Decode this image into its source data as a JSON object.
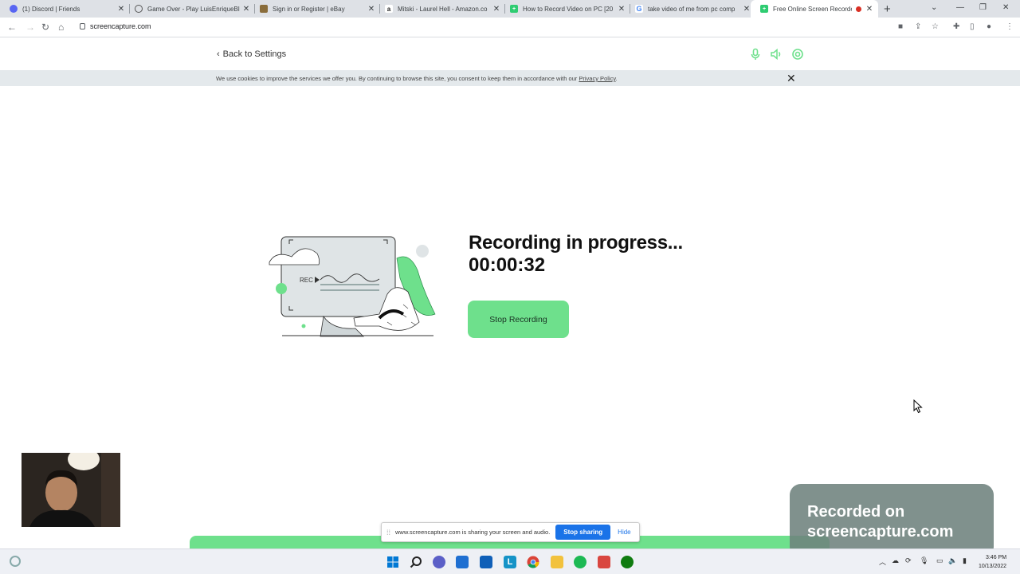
{
  "browser": {
    "tabs": [
      {
        "title": "(1) Discord | Friends",
        "favicon": "discord-icon",
        "color": "#5865f2"
      },
      {
        "title": "Game Over - Play LuisEnriqueBl",
        "favicon": "game-icon",
        "color": "#555555"
      },
      {
        "title": "Sign in or Register | eBay",
        "favicon": "bag-icon",
        "color": "#8a6d3b"
      },
      {
        "title": "Mitski - Laurel Hell - Amazon.co",
        "favicon": "amazon-icon",
        "color": "#222222"
      },
      {
        "title": "How to Record Video on PC [20",
        "favicon": "screencapture-icon",
        "color": "#2ecc71"
      },
      {
        "title": "take video of me from pc comp",
        "favicon": "google-icon",
        "color": "#4285f4"
      },
      {
        "title": "Free Online Screen Recorde",
        "favicon": "screencapture-icon",
        "color": "#2ecc71",
        "active": true
      }
    ],
    "new_tab": "+",
    "url": "screencapture.com"
  },
  "header": {
    "back_label": "Back to Settings",
    "icons": [
      "microphone-icon",
      "speaker-icon",
      "webcam-icon"
    ],
    "accent": "#6ee08c"
  },
  "cookie_banner": {
    "text": "We use cookies to improve the services we offer you. By continuing to browse this site, you consent to keep them in accordance with our",
    "link": "Privacy Policy",
    "period": "."
  },
  "recording": {
    "illustration_label": "REC",
    "status": "Recording in progress...",
    "timer": "00:00:32",
    "stop_button": "Stop Recording"
  },
  "share_bar": {
    "grip": "⁞⁞",
    "message": "www.screencapture.com is sharing your screen and audio.",
    "stop_label": "Stop sharing",
    "hide_label": "Hide"
  },
  "watermark": {
    "line1": "Recorded on",
    "line2": "screencapture.com"
  },
  "taskbar": {
    "time": "3:46 PM",
    "date": "10/13/2022",
    "apps": [
      "windows-start-icon",
      "search-icon",
      "chat-icon",
      "store-icon",
      "mail-icon",
      "l-app-icon",
      "chrome-icon",
      "file-explorer-icon",
      "spotify-icon",
      "snipping-icon",
      "xbox-icon"
    ]
  }
}
